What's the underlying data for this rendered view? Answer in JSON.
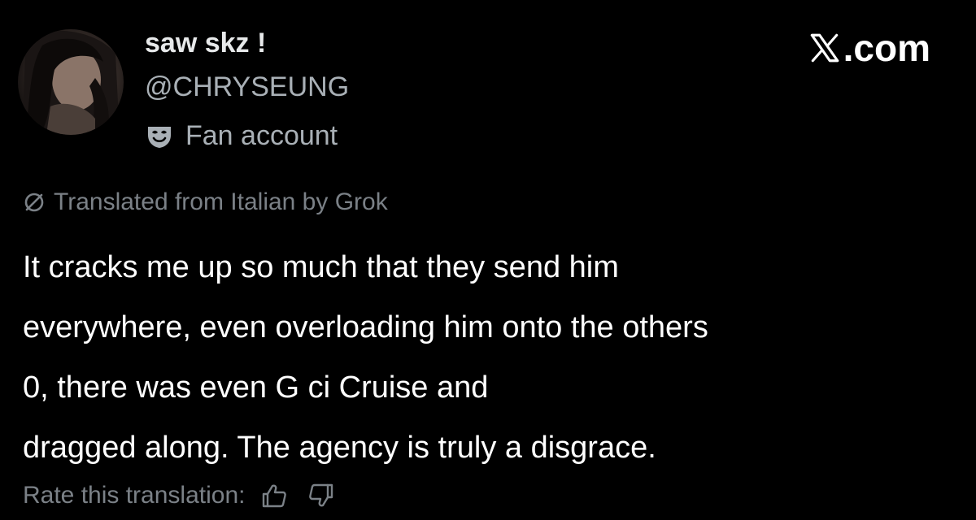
{
  "author": {
    "display_name": "saw skz !",
    "handle": "@CHRYSEUNG",
    "affiliation_label": "Fan account",
    "affiliation_icon": "mask-icon"
  },
  "site": {
    "label": ".com",
    "logo_icon": "x-logo-icon"
  },
  "translation": {
    "note": "Translated from Italian by Grok",
    "icon": "translate-slash-icon"
  },
  "tweet": {
    "lines": [
      "It cracks me up so much that they send him",
      "everywhere, even overloading him onto the others",
      "0, there was even G    ci Cruise and",
      "dragged along. The agency is truly a disgrace."
    ]
  },
  "rating": {
    "label": "Rate this translation:",
    "like_icon": "thumbs-up-icon",
    "dislike_icon": "thumbs-down-icon"
  },
  "colors": {
    "background": "#000000",
    "primary_text": "#e7e9ea",
    "secondary_text": "#a9b0b6",
    "muted_text": "#7b8187"
  }
}
